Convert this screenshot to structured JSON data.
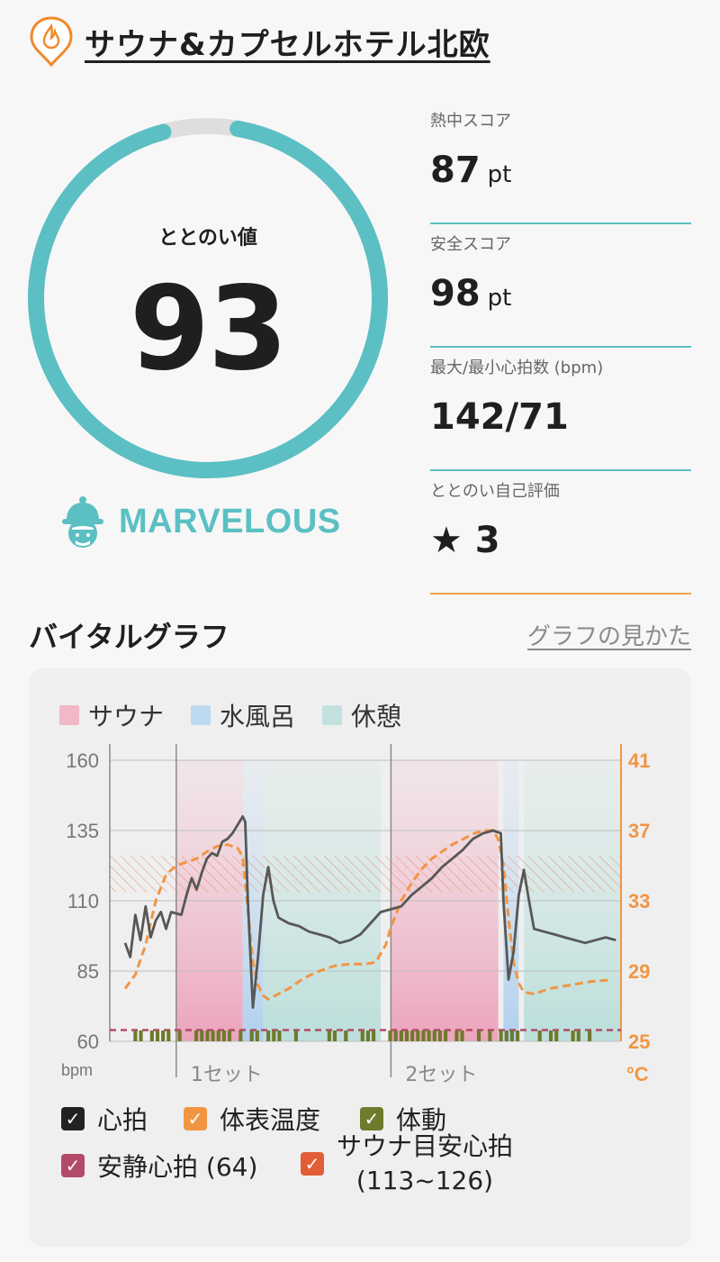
{
  "header": {
    "title": "サウナ&カプセルホテル北欧"
  },
  "score": {
    "label": "ととのい値",
    "value": "93",
    "mood": "MARVELOUS",
    "fraction": 0.93
  },
  "stats": [
    {
      "label": "熱中スコア",
      "value": "87",
      "unit": "pt"
    },
    {
      "label": "安全スコア",
      "value": "98",
      "unit": "pt"
    },
    {
      "label": "最大/最小心拍数 (bpm)",
      "value": "142/71",
      "unit": ""
    },
    {
      "label": "ととのい自己評価",
      "value": "★ 3",
      "unit": ""
    }
  ],
  "section": {
    "title": "バイタルグラフ",
    "link": "グラフの見かた"
  },
  "legend": [
    {
      "label": "サウナ",
      "color": "#f1b8c7"
    },
    {
      "label": "水風呂",
      "color": "#bcd9f0"
    },
    {
      "label": "休憩",
      "color": "#c2e2df"
    }
  ],
  "chart_data": {
    "type": "line",
    "y_left": {
      "unit": "bpm",
      "ticks": [
        "160",
        "135",
        "110",
        "85",
        "60"
      ],
      "range": [
        60,
        160
      ]
    },
    "y_right": {
      "unit": "°C",
      "ticks": [
        "41",
        "37",
        "33",
        "29",
        "25"
      ],
      "range": [
        25,
        41
      ]
    },
    "x_labels": [
      "1セット",
      "2セット"
    ],
    "x_range": [
      0,
      100
    ],
    "phases": [
      {
        "type": "sauna",
        "start": 13,
        "end": 26
      },
      {
        "type": "cold",
        "start": 26,
        "end": 30
      },
      {
        "type": "rest",
        "start": 30,
        "end": 53
      },
      {
        "type": "sauna",
        "start": 55,
        "end": 76
      },
      {
        "type": "cold",
        "start": 77,
        "end": 80
      },
      {
        "type": "rest",
        "start": 81,
        "end": 100
      }
    ],
    "series": [
      {
        "name": "心拍",
        "color": "#575757",
        "axis": "left",
        "points": [
          [
            3,
            95
          ],
          [
            4,
            90
          ],
          [
            5,
            105
          ],
          [
            6,
            96
          ],
          [
            7,
            108
          ],
          [
            8,
            97
          ],
          [
            9,
            103
          ],
          [
            10,
            106
          ],
          [
            11,
            100
          ],
          [
            12,
            106
          ],
          [
            14,
            105
          ],
          [
            15,
            112
          ],
          [
            16,
            118
          ],
          [
            17,
            114
          ],
          [
            18,
            120
          ],
          [
            19,
            125
          ],
          [
            20,
            127
          ],
          [
            21,
            126
          ],
          [
            22,
            131
          ],
          [
            23,
            132
          ],
          [
            24,
            134
          ],
          [
            25,
            137
          ],
          [
            26,
            140
          ],
          [
            26.5,
            138
          ],
          [
            27,
            110
          ],
          [
            28,
            72
          ],
          [
            29,
            90
          ],
          [
            30,
            112
          ],
          [
            31,
            122
          ],
          [
            32,
            110
          ],
          [
            33,
            104
          ],
          [
            35,
            102
          ],
          [
            37,
            101
          ],
          [
            39,
            99
          ],
          [
            41,
            98
          ],
          [
            43,
            97
          ],
          [
            45,
            95
          ],
          [
            47,
            96
          ],
          [
            49,
            98
          ],
          [
            51,
            102
          ],
          [
            53,
            106
          ],
          [
            55,
            107
          ],
          [
            57,
            108
          ],
          [
            59,
            112
          ],
          [
            61,
            115
          ],
          [
            63,
            118
          ],
          [
            65,
            122
          ],
          [
            67,
            125
          ],
          [
            69,
            128
          ],
          [
            71,
            132
          ],
          [
            73,
            134
          ],
          [
            75,
            135
          ],
          [
            76.5,
            134
          ],
          [
            77,
            110
          ],
          [
            78,
            82
          ],
          [
            79,
            92
          ],
          [
            80,
            112
          ],
          [
            81,
            121
          ],
          [
            82,
            110
          ],
          [
            83,
            100
          ],
          [
            85,
            99
          ],
          [
            87,
            98
          ],
          [
            89,
            97
          ],
          [
            91,
            96
          ],
          [
            93,
            95
          ],
          [
            95,
            96
          ],
          [
            97,
            97
          ],
          [
            99,
            96
          ]
        ]
      },
      {
        "name": "体表温度",
        "color": "#f29543",
        "axis": "right",
        "points": [
          [
            3,
            28.0
          ],
          [
            5,
            28.8
          ],
          [
            7,
            30.5
          ],
          [
            9,
            33.0
          ],
          [
            11,
            34.5
          ],
          [
            13,
            35.0
          ],
          [
            15,
            35.2
          ],
          [
            17,
            35.4
          ],
          [
            19,
            35.8
          ],
          [
            21,
            36.1
          ],
          [
            23,
            36.2
          ],
          [
            25,
            36.0
          ],
          [
            26,
            35.5
          ],
          [
            27,
            32.5
          ],
          [
            28,
            29.5
          ],
          [
            29,
            28.2
          ],
          [
            30,
            27.6
          ],
          [
            31,
            27.4
          ],
          [
            33,
            27.7
          ],
          [
            35,
            28.0
          ],
          [
            38,
            28.6
          ],
          [
            41,
            29.0
          ],
          [
            44,
            29.3
          ],
          [
            47,
            29.4
          ],
          [
            50,
            29.4
          ],
          [
            52,
            29.5
          ],
          [
            54,
            30.5
          ],
          [
            55,
            31.5
          ],
          [
            57,
            33.0
          ],
          [
            59,
            34.0
          ],
          [
            61,
            34.8
          ],
          [
            63,
            35.4
          ],
          [
            65,
            35.8
          ],
          [
            67,
            36.2
          ],
          [
            69,
            36.5
          ],
          [
            71,
            36.8
          ],
          [
            73,
            37.0
          ],
          [
            75,
            37.0
          ],
          [
            76,
            36.5
          ],
          [
            77,
            35.0
          ],
          [
            78,
            32.0
          ],
          [
            79,
            29.5
          ],
          [
            80,
            28.3
          ],
          [
            81,
            27.8
          ],
          [
            83,
            27.7
          ],
          [
            86,
            28.0
          ],
          [
            90,
            28.2
          ],
          [
            94,
            28.4
          ],
          [
            98,
            28.5
          ]
        ]
      }
    ],
    "resting_hr": 64,
    "sauna_target_hr": [
      113,
      126
    ]
  },
  "checks": [
    {
      "label": "心拍",
      "color": "#222222"
    },
    {
      "label": "体表温度",
      "color": "#f29543"
    },
    {
      "label": "体動",
      "color": "#6f7a2c"
    },
    {
      "label": "安静心拍 (64)",
      "color": "#b34a6a"
    },
    {
      "label": "サウナ目安心拍",
      "label2": "(113~126)",
      "color": "#e25c35"
    }
  ]
}
